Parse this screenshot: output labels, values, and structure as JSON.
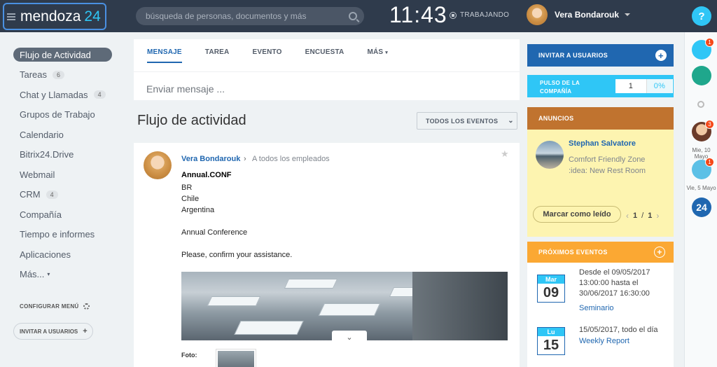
{
  "header": {
    "logo": "mendoza",
    "logo_number": "24",
    "search_placeholder": "búsqueda de personas, documentos y más",
    "clock": "11:43",
    "work_status": "TRABAJANDO",
    "user_name": "Vera Bondarouk",
    "help": "?"
  },
  "sidebar": {
    "items": [
      {
        "label": "Flujo de Actividad",
        "count": ""
      },
      {
        "label": "Tareas",
        "count": "6"
      },
      {
        "label": "Chat y Llamadas",
        "count": "4"
      },
      {
        "label": "Grupos de Trabajo",
        "count": ""
      },
      {
        "label": "Calendario",
        "count": ""
      },
      {
        "label": "Bitrix24.Drive",
        "count": ""
      },
      {
        "label": "Webmail",
        "count": ""
      },
      {
        "label": "CRM",
        "count": "4"
      },
      {
        "label": "Compañía",
        "count": ""
      },
      {
        "label": "Tiempo e informes",
        "count": ""
      },
      {
        "label": "Aplicaciones",
        "count": ""
      },
      {
        "label": "Más...",
        "count": ""
      }
    ],
    "configure": "CONFIGURAR MENÚ",
    "invite": "INVITAR A USUARIOS"
  },
  "composer": {
    "tabs": [
      "MENSAJE",
      "TAREA",
      "EVENTO",
      "ENCUESTA",
      "MÁS"
    ],
    "placeholder": "Enviar mensaje ..."
  },
  "feed": {
    "title": "Flujo de actividad",
    "filter": "TODOS LOS EVENTOS"
  },
  "post": {
    "author": "Vera Bondarouk",
    "audience": "A todos los empleados",
    "title": "Annual.CONF",
    "lines": [
      "BR",
      "Chile",
      "Argentina",
      "Annual Conference",
      "Please, confirm your assistance."
    ],
    "photo_label": "Foto:"
  },
  "right": {
    "invite": "INVITAR A USUARIOS",
    "pulse_label_1": "PULSO DE LA",
    "pulse_label_2": "COMPAÑÍA",
    "pulse_value": "1",
    "pulse_percent": "0%",
    "announcements": {
      "title": "ANUNCIOS",
      "author": "Stephan Salvatore",
      "text_1": "Comfort Friendly Zone",
      "text_2": ":idea: New Rest Room",
      "read_button": "Marcar como leído",
      "page_current": "1",
      "page_sep": "/",
      "page_total": "1"
    },
    "events": {
      "title": "PRÓXIMOS EVENTOS",
      "items": [
        {
          "month": "Mar",
          "day": "09",
          "line1": "Desde el 09/05/2017",
          "line2": "13:00:00 hasta el",
          "line3": "30/06/2017 16:30:00",
          "name": "Seminario"
        },
        {
          "month": "Lu",
          "day": "15",
          "line1": "15/05/2017, todo el día",
          "name": "Weekly Report"
        }
      ]
    }
  },
  "rightbar": {
    "notifications_count": "1",
    "messages_count": "3",
    "date_1": "Mie, 10 Mayo",
    "upload_count": "1",
    "date_2": "Vie, 5 Mayo",
    "b24": "24"
  },
  "colors": {
    "topbar": "#2f3b4c",
    "accent_blue": "#2067b0",
    "cyan": "#2fc6f6",
    "announcement_header": "#c0732f",
    "events_header": "#fba833"
  }
}
